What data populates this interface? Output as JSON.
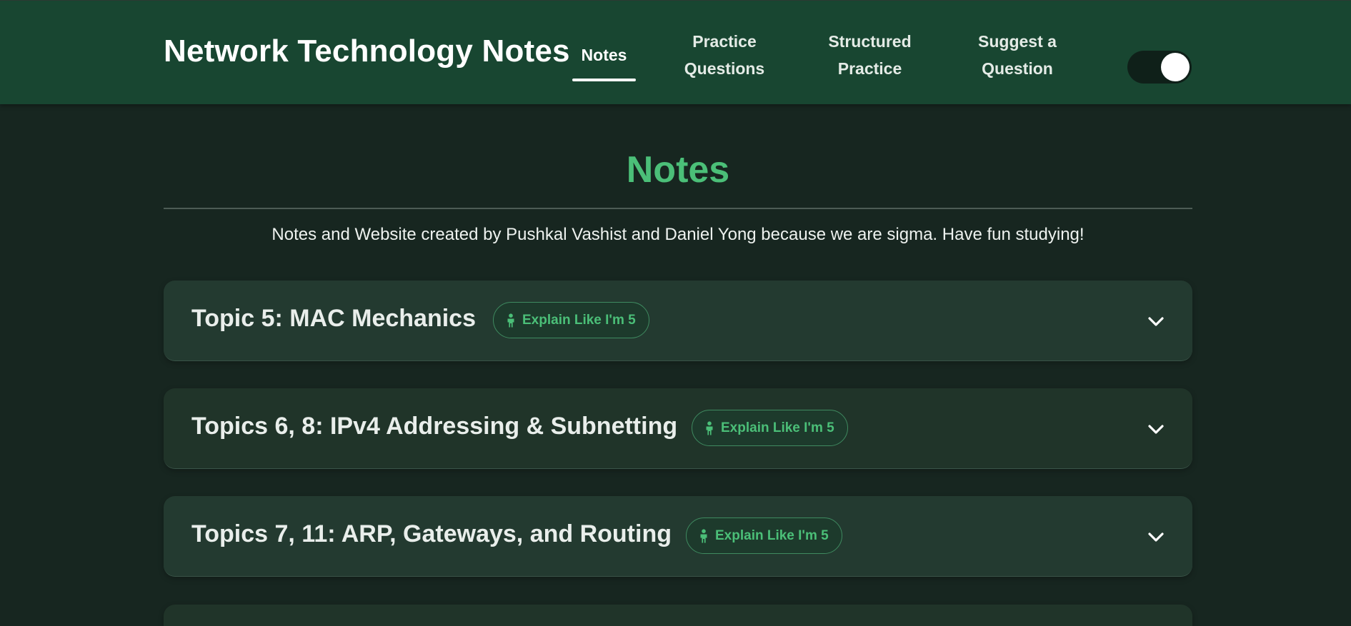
{
  "header": {
    "brand": "Network Technology Notes",
    "nav": [
      {
        "line1": "Notes",
        "line2": ""
      },
      {
        "line1": "Practice",
        "line2": "Questions"
      },
      {
        "line1": "Structured",
        "line2": "Practice"
      },
      {
        "line1": "Suggest a",
        "line2": "Question"
      }
    ],
    "active_nav": "Notes"
  },
  "main": {
    "title": "Notes",
    "intro": "Notes and Website created by Pushkal Vashist and Daniel Yong because we are sigma. Have fun studying!",
    "topics": [
      {
        "title": "Topic 5: MAC Mechanics",
        "badge": "Explain Like I'm 5"
      },
      {
        "title": "Topics 6, 8: IPv4 Addressing & Subnetting",
        "badge": "Explain Like I'm 5"
      },
      {
        "title": "Topics 7, 11: ARP, Gateways, and Routing",
        "badge": "Explain Like I'm 5"
      },
      {
        "title": "",
        "badge": ""
      }
    ]
  },
  "icons": {
    "badge_icon": "child-icon",
    "expand_icon": "chevron-down-icon",
    "theme_toggle": "toggle-switch"
  },
  "colors": {
    "header_bg": "#184631",
    "page_bg": "#172620",
    "accent": "#4bbf78",
    "card_bg": "#203429"
  }
}
